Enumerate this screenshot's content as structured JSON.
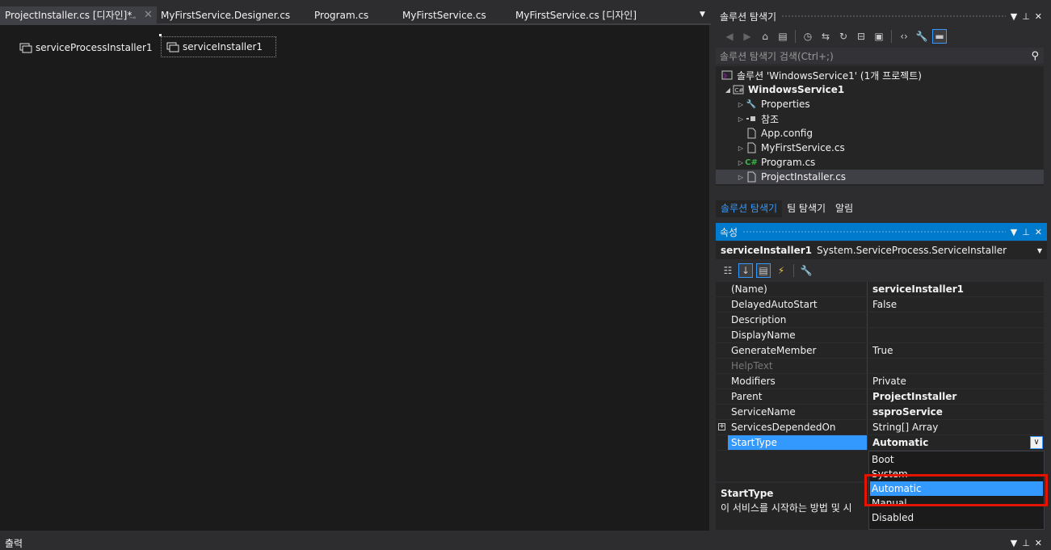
{
  "tabs": [
    {
      "label": "ProjectInstaller.cs [디자인]*",
      "active": true
    },
    {
      "label": "MyFirstService.Designer.cs"
    },
    {
      "label": "Program.cs"
    },
    {
      "label": "MyFirstService.cs"
    },
    {
      "label": "MyFirstService.cs [디자인]"
    }
  ],
  "designer": {
    "components": [
      {
        "label": "serviceProcessInstaller1"
      },
      {
        "label": "serviceInstaller1",
        "selected": true
      }
    ]
  },
  "solution_explorer": {
    "title": "솔루션 탐색기",
    "search_placeholder": "솔루션 탐색기 검색(Ctrl+;)",
    "tree": [
      {
        "label": "솔루션 'WindowsService1' (1개 프로젝트)"
      },
      {
        "label": "WindowsService1",
        "bold": true
      },
      {
        "label": "Properties"
      },
      {
        "label": "참조"
      },
      {
        "label": "App.config"
      },
      {
        "label": "MyFirstService.cs"
      },
      {
        "label": "Program.cs"
      },
      {
        "label": "ProjectInstaller.cs",
        "selected": true
      }
    ],
    "bottom_tabs": [
      {
        "label": "솔루션 탐색기",
        "active": true
      },
      {
        "label": "팀 탐색기"
      },
      {
        "label": "알림"
      }
    ]
  },
  "properties": {
    "title": "속성",
    "object_name": "serviceInstaller1",
    "object_type": "System.ServiceProcess.ServiceInstaller",
    "rows": [
      {
        "name": "(Name)",
        "value": "serviceInstaller1",
        "bold": true
      },
      {
        "name": "DelayedAutoStart",
        "value": "False"
      },
      {
        "name": "Description",
        "value": ""
      },
      {
        "name": "DisplayName",
        "value": ""
      },
      {
        "name": "GenerateMember",
        "value": "True"
      },
      {
        "name": "HelpText",
        "value": "",
        "disabled": true
      },
      {
        "name": "Modifiers",
        "value": "Private"
      },
      {
        "name": "Parent",
        "value": "ProjectInstaller",
        "bold": true
      },
      {
        "name": "ServiceName",
        "value": "ssproService",
        "bold": true
      },
      {
        "name": "ServicesDependedOn",
        "value": "String[] Array",
        "expandable": true
      },
      {
        "name": "StartType",
        "value": "Automatic",
        "bold": true,
        "selected": true
      }
    ],
    "dropdown_options": [
      "Boot",
      "System",
      "Automatic",
      "Manual",
      "Disabled"
    ],
    "dropdown_selected": "Automatic",
    "description_title": "StartType",
    "description_text": "이 서비스를 시작하는 방법 및 시"
  },
  "output": {
    "title": "출력"
  },
  "colors": {
    "accent": "#007acc",
    "selection": "#3399ff",
    "highlight_box": "#e51400"
  }
}
